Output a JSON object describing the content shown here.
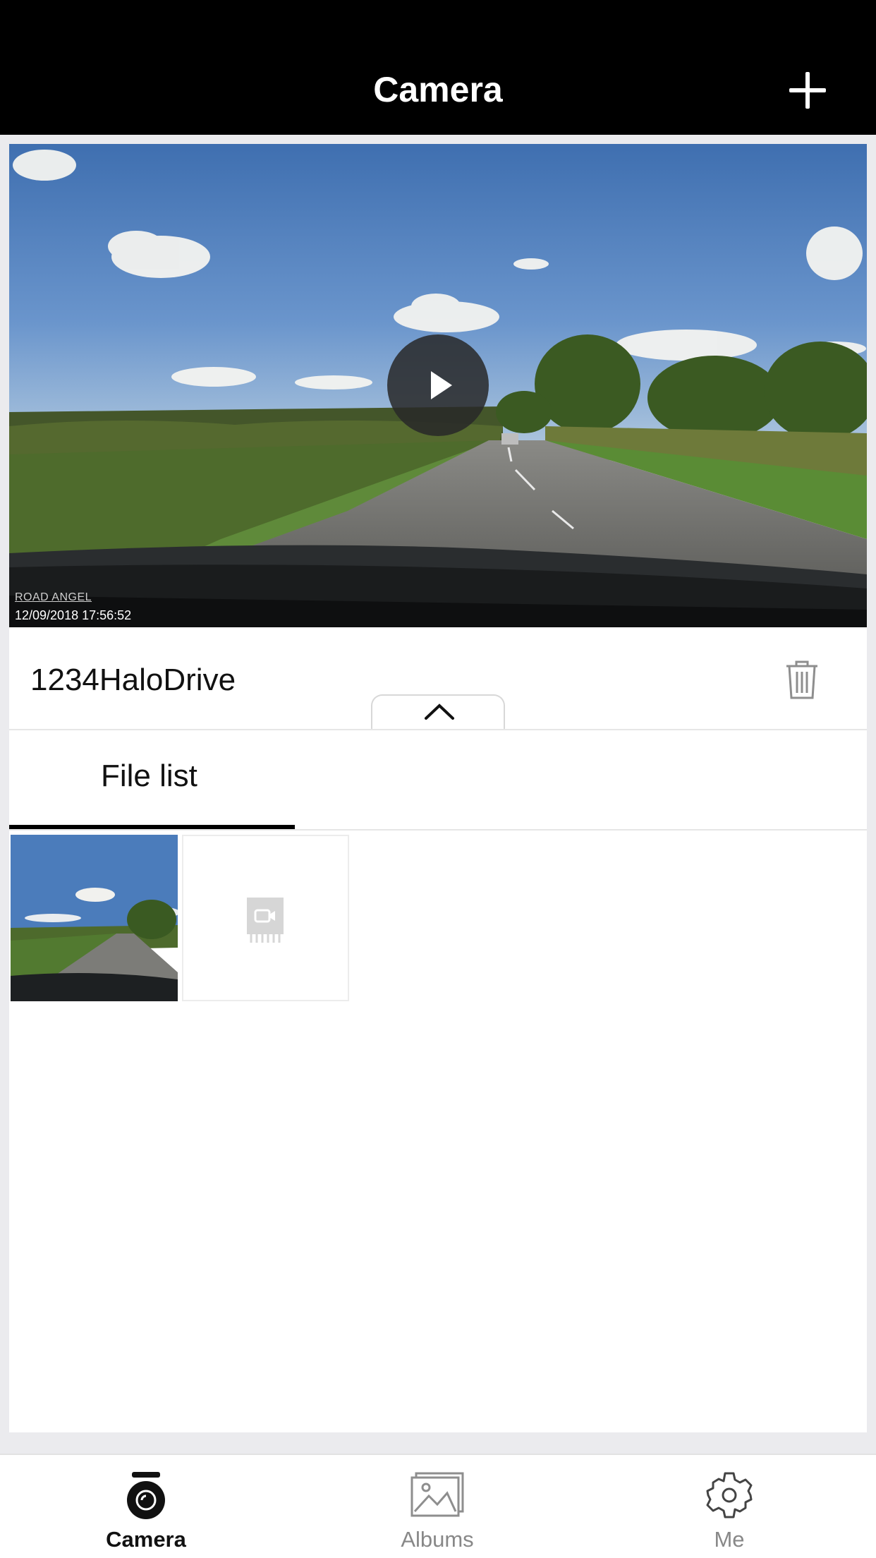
{
  "header": {
    "title": "Camera",
    "add_icon": "plus-icon"
  },
  "preview": {
    "brand_text": "ROAD ANGEL",
    "timestamp": "12/09/2018  17:56:52",
    "play_icon": "play-icon"
  },
  "device": {
    "name": "1234HaloDrive",
    "delete_icon": "trash-icon",
    "collapse_icon": "chevron-up-icon"
  },
  "tabs": [
    {
      "label": "File list",
      "active": true
    }
  ],
  "files": [
    {
      "type": "video-thumbnail"
    },
    {
      "type": "placeholder",
      "icon": "video-file-icon"
    }
  ],
  "bottom_nav": [
    {
      "label": "Camera",
      "icon": "dashcam-icon",
      "active": true
    },
    {
      "label": "Albums",
      "icon": "photo-icon",
      "active": false
    },
    {
      "label": "Me",
      "icon": "gear-icon",
      "active": false
    }
  ],
  "colors": {
    "header_bg": "#000000",
    "active_tab": "#000000",
    "inactive_nav": "#888888"
  }
}
